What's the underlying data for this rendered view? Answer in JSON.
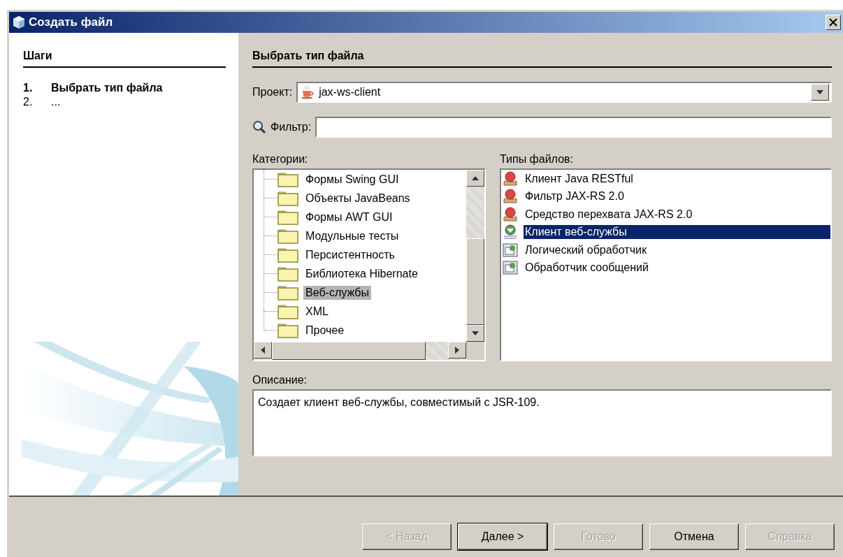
{
  "window": {
    "title": "Создать файл"
  },
  "steps": {
    "title": "Шаги",
    "items": [
      {
        "number": "1.",
        "label": "Выбрать тип файла",
        "current": true
      },
      {
        "number": "2.",
        "label": "...",
        "current": false
      }
    ]
  },
  "panel": {
    "title": "Выбрать тип файла"
  },
  "project": {
    "label": "Проект:",
    "value": "jax-ws-client"
  },
  "filter": {
    "label": "Фильтр:"
  },
  "categories": {
    "label": "Категории:",
    "items": [
      {
        "label": "Формы Swing GUI",
        "selected": false
      },
      {
        "label": "Объекты JavaBeans",
        "selected": false
      },
      {
        "label": "Формы AWT GUI",
        "selected": false
      },
      {
        "label": "Модульные тесты",
        "selected": false
      },
      {
        "label": "Персистентность",
        "selected": false
      },
      {
        "label": "Библиотека Hibernate",
        "selected": false
      },
      {
        "label": "Веб-службы",
        "selected": true
      },
      {
        "label": "XML",
        "selected": false
      },
      {
        "label": "Прочее",
        "selected": false
      }
    ]
  },
  "file_types": {
    "label": "Типы файлов:",
    "items": [
      {
        "label": "Клиент Java RESTful",
        "kind": "rest",
        "selected": false
      },
      {
        "label": "Фильтр JAX-RS 2.0",
        "kind": "rest",
        "selected": false
      },
      {
        "label": "Средство перехвата JAX-RS 2.0",
        "kind": "rest",
        "selected": false
      },
      {
        "label": "Клиент веб-службы",
        "kind": "webservice",
        "selected": true
      },
      {
        "label": "Логический обработчик",
        "kind": "handler",
        "selected": false
      },
      {
        "label": "Обработчик сообщений",
        "kind": "handler",
        "selected": false
      }
    ]
  },
  "description": {
    "label": "Описание:",
    "text": "Создает клиент веб-службы, совместимый с JSR-109."
  },
  "buttons": [
    {
      "label": "< Назад",
      "disabled": true,
      "default": false
    },
    {
      "label": "Далее >",
      "disabled": false,
      "default": true
    },
    {
      "label": "Готово",
      "disabled": true,
      "default": false
    },
    {
      "label": "Отмена",
      "disabled": false,
      "default": false
    },
    {
      "label": "Справка",
      "disabled": true,
      "default": false
    }
  ]
}
